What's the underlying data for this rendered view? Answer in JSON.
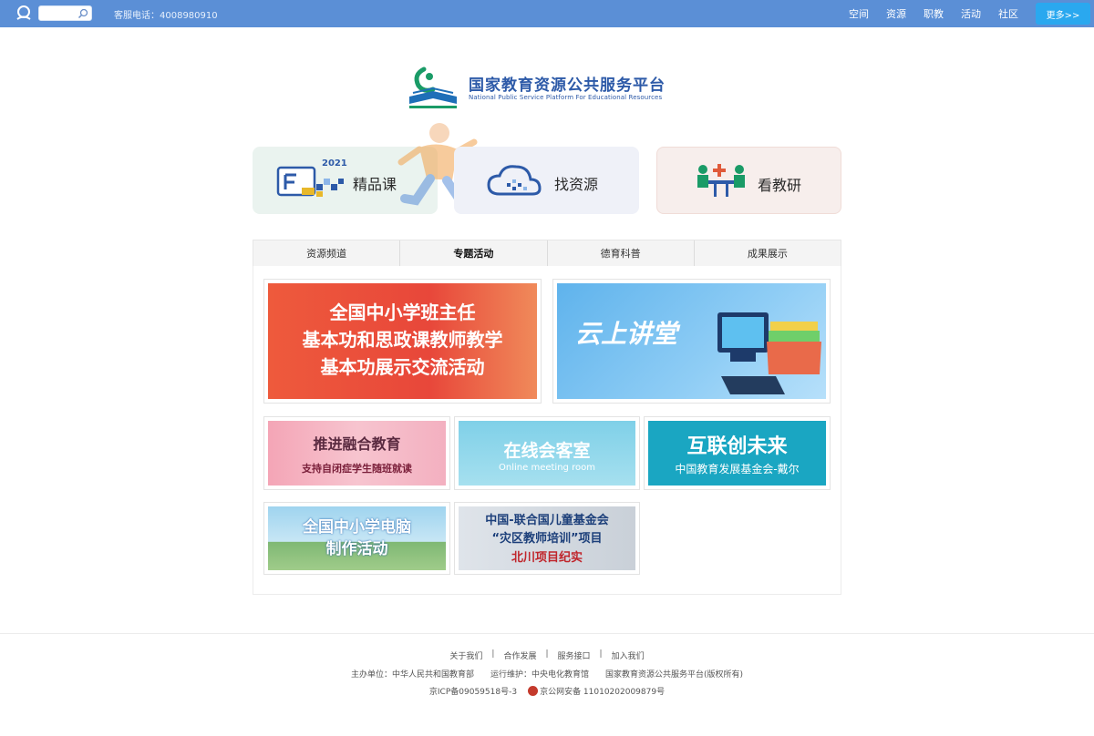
{
  "topbar": {
    "phone": "客服电话：4008980910",
    "nav": [
      "空间",
      "资源",
      "职教",
      "活动",
      "社区"
    ],
    "more": "更多>>"
  },
  "logo": {
    "cn": "国家教育资源公共服务平台",
    "en": "National Public Service Platform For Educational Resources"
  },
  "features": [
    {
      "label": "精品课",
      "badge": "2021"
    },
    {
      "label": "找资源"
    },
    {
      "label": "看教研"
    }
  ],
  "tabs": [
    "资源频道",
    "专题活动",
    "德育科普",
    "成果展示"
  ],
  "active_tab": 1,
  "banners": {
    "b1": [
      "全国中小学班主任",
      "基本功和思政课教师教学",
      "基本功展示交流活动"
    ],
    "b2": "云上讲堂",
    "b3": {
      "title": "推进融合教育",
      "sub": "支持自闭症学生随班就读"
    },
    "b4": {
      "title": "在线会客室",
      "sub": "Online meeting room"
    },
    "b5": {
      "title": "互联创未来",
      "sub": "中国教育发展基金会-戴尔"
    },
    "b6": [
      "全国中小学电脑",
      "制作活动"
    ],
    "b7": [
      "中国-联合国儿童基金会",
      "“灾区教师培训”项目",
      "北川项目纪实"
    ]
  },
  "footer": {
    "links": [
      "关于我们",
      "合作发展",
      "服务接口",
      "加入我们"
    ],
    "sep": "|",
    "host": "主办单位：中华人民共和国教育部",
    "operator": "运行维护：中央电化教育馆",
    "copyright": "国家教育资源公共服务平台(版权所有)",
    "icp": "京ICP备09059518号-3",
    "police": "京公网安备 11010202009879号"
  },
  "colors": {
    "topbar": "#5b8fd6",
    "more_button": "#2aa8ef",
    "brand": "#2d5aa8"
  }
}
